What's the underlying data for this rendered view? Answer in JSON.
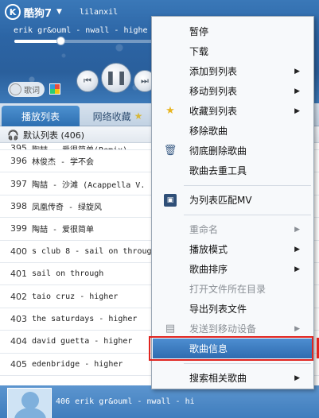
{
  "app": {
    "logo_text": "酷狗7",
    "username": "lilanxil",
    "current_track": "erik gr&ouml - nwall - highe"
  },
  "player": {
    "lyric_button": "歌词",
    "progress_fraction": 0.33
  },
  "tabs": [
    {
      "label": "播放列表"
    },
    {
      "label": "网络收藏"
    }
  ],
  "playlist": {
    "header": "默认列表 (406)",
    "partial_row": {
      "num": "395",
      "title": "陶喆 - 爱很简单(Remix)"
    },
    "rows": [
      {
        "num": "396",
        "title": "林俊杰 - 学不会"
      },
      {
        "num": "397",
        "title": "陶喆 - 沙滩 (Acappella V."
      },
      {
        "num": "398",
        "title": "凤凰传奇 - 绿旋风"
      },
      {
        "num": "399",
        "title": "陶喆 - 爱很简单"
      },
      {
        "num": "400",
        "title": "s club 8 - sail on throug"
      },
      {
        "num": "401",
        "title": "sail on through"
      },
      {
        "num": "402",
        "title": "taio cruz - higher"
      },
      {
        "num": "403",
        "title": "the saturdays - higher"
      },
      {
        "num": "404",
        "title": "david guetta - higher"
      },
      {
        "num": "405",
        "title": "edenbridge - higher"
      }
    ]
  },
  "now_playing": {
    "num": "406",
    "text": "erik gr&ouml - nwall - hi"
  },
  "context_menu": {
    "items": [
      {
        "label": "暂停"
      },
      {
        "label": "下载"
      },
      {
        "label": "添加到列表"
      },
      {
        "label": "移动到列表"
      },
      {
        "label": "收藏到列表"
      },
      {
        "label": "移除歌曲"
      },
      {
        "label": "彻底删除歌曲"
      },
      {
        "label": "歌曲去重工具"
      },
      {
        "label": "为列表匹配MV"
      },
      {
        "label": "重命名"
      },
      {
        "label": "播放模式"
      },
      {
        "label": "歌曲排序"
      },
      {
        "label": "打开文件所在目录"
      },
      {
        "label": "导出列表文件"
      },
      {
        "label": "发送到移动设备"
      },
      {
        "label": "歌曲信息"
      },
      {
        "label": "搜索相关歌曲"
      }
    ]
  },
  "colors": {
    "accent": "#2f6cb0",
    "highlight_border": "#e0241f",
    "menu_bg": "#f7f9fb"
  },
  "icons": [
    "logo-k-icon",
    "headphone-icon",
    "star-icon",
    "trash-icon",
    "mv-icon",
    "send-device-icon",
    "submenu-arrow-icon"
  ]
}
